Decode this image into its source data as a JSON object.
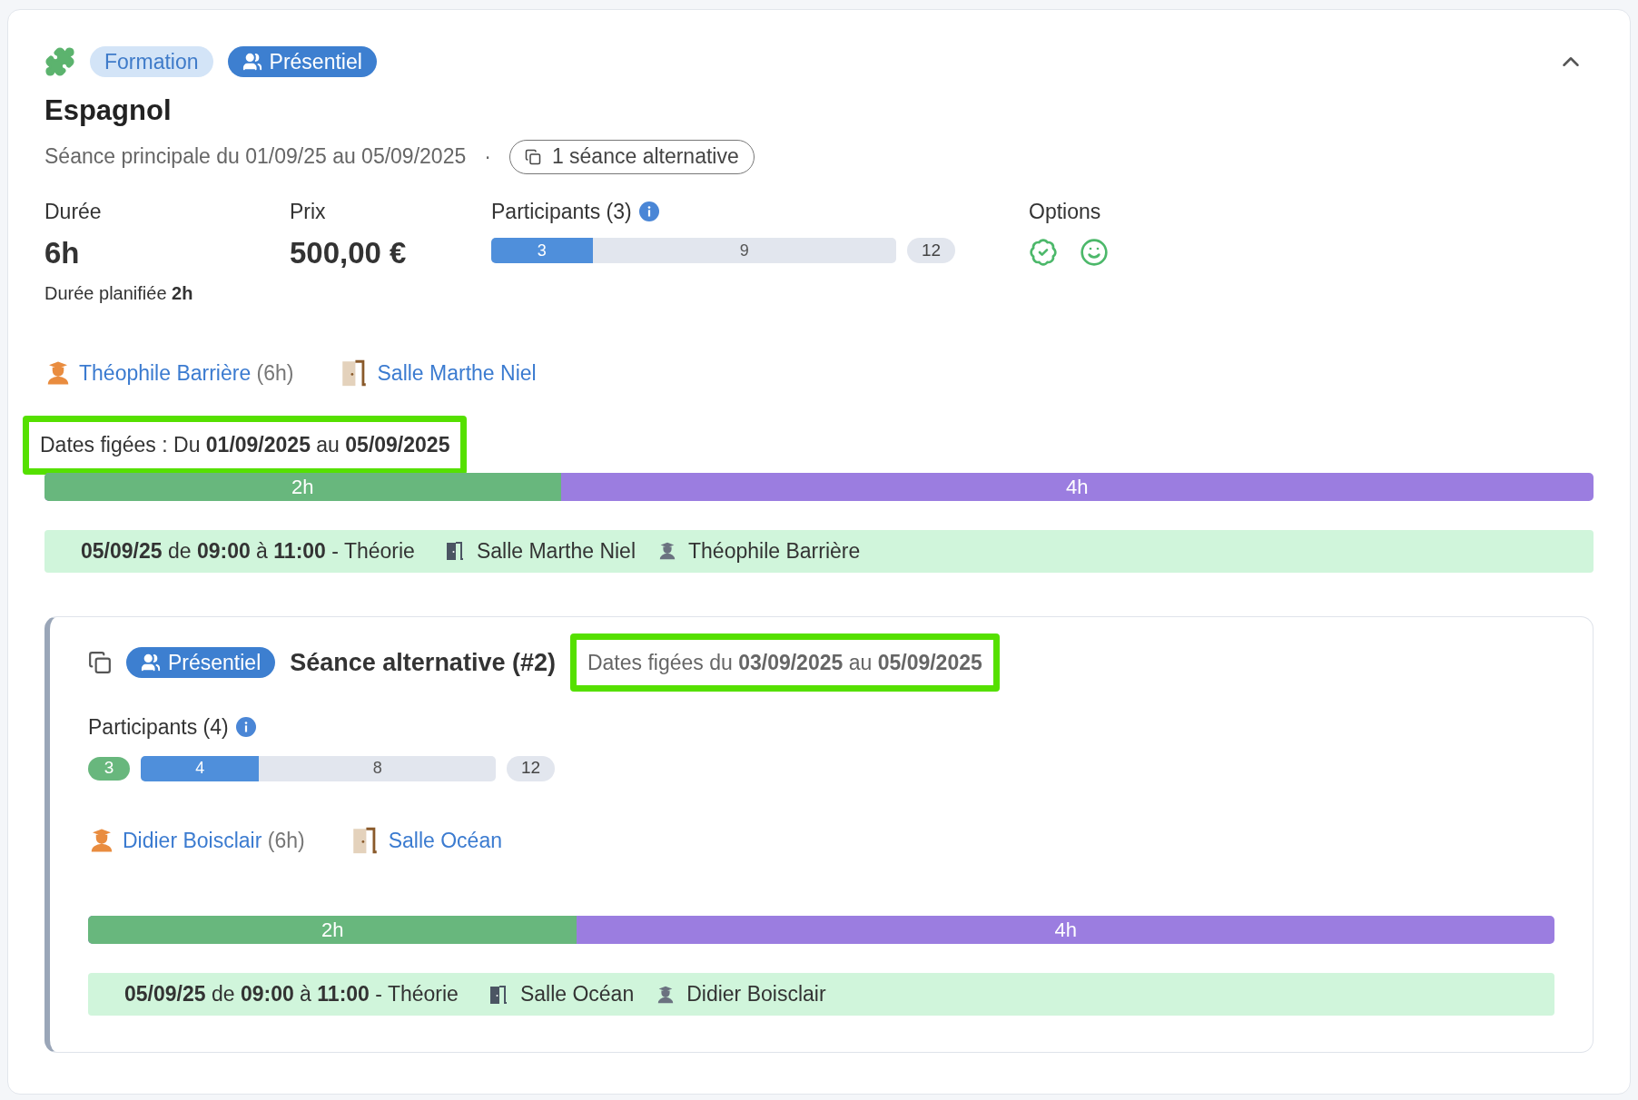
{
  "header": {
    "tags": [
      {
        "label": "Formation",
        "kind": "pale"
      },
      {
        "label": "Présentiel",
        "kind": "solid"
      }
    ],
    "expanded": true
  },
  "title": "Espagnol",
  "subtitle": "Séance principale du 01/09/25 au 05/09/2025",
  "separator": "·",
  "alternatives_button": "1 séance alternative",
  "stats": {
    "duration": {
      "label": "Durée",
      "value": "6h",
      "planned": "Durée planifiée **2h**"
    },
    "price": {
      "label": "Prix",
      "value": "500,00 €"
    },
    "participants": {
      "label": "Participants (3)",
      "filled": "3",
      "remaining": "9",
      "level": 0.25,
      "total": "12"
    },
    "options": {
      "label": "Options"
    }
  },
  "trainer": {
    "name": "Théophile Barrière",
    "hours": "(6h)"
  },
  "room": "Salle Marthe Niel",
  "frozen_dates": {
    "text": "Dates figées :  Du **01/09/2025** au **05/09/2025**",
    "highlighted": true
  },
  "timeline": [
    {
      "label": "2h",
      "level": 0.3333,
      "color": "#68b77d"
    },
    {
      "label": "4h",
      "color": "#9b7de0"
    }
  ],
  "sessions": [
    {
      "when": "**05/09/25** de **09:00** à **11:00** - Théorie",
      "room": "Salle Marthe Niel",
      "trainer": "Théophile Barrière"
    }
  ],
  "alternative": {
    "tag": "Présentiel",
    "title": "Séance alternative (#2)",
    "frozen_dates": {
      "text": "Dates figées du **03/09/2025** au **05/09/2025**",
      "highlighted": true
    },
    "participants": {
      "label": "Participants (4)",
      "confirmed": "3",
      "filled": "4",
      "remaining": "8",
      "level": 0.3333,
      "total": "12"
    },
    "trainer": {
      "name": "Didier Boisclair",
      "hours": "(6h)"
    },
    "room": "Salle Océan",
    "timeline": [
      {
        "label": "2h",
        "level": 0.3333,
        "color": "#68b77d"
      },
      {
        "label": "4h",
        "color": "#9b7de0"
      }
    ],
    "sessions": [
      {
        "when": "**05/09/25** de **09:00** à **11:00** - Théorie",
        "room": "Salle Océan",
        "trainer": "Didier Boisclair"
      }
    ]
  }
}
